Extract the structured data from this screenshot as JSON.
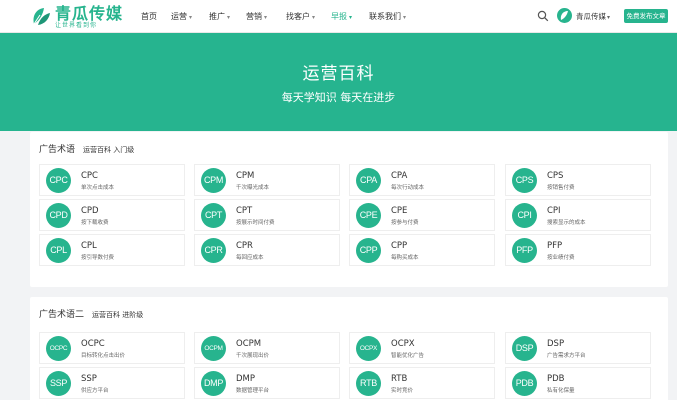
{
  "brand": {
    "name": "青瓜传媒",
    "slogan": "让世界看到你",
    "color": "#27b48e"
  },
  "nav": [
    {
      "label": "首页",
      "caret": ""
    },
    {
      "label": "运营",
      "caret": "▾"
    },
    {
      "label": "推广",
      "caret": "▾"
    },
    {
      "label": "营销",
      "caret": "▾"
    },
    {
      "label": "找客户",
      "caret": "▾"
    },
    {
      "label": "早报",
      "caret": "▾"
    },
    {
      "label": "联系我们",
      "caret": "▾"
    }
  ],
  "header": {
    "username": "青瓜传媒",
    "user_caret": "▾",
    "publish_label": "免费发布文章"
  },
  "banner": {
    "title": "运营百科",
    "subtitle": "每天学知识 每天在进步"
  },
  "section1": {
    "title": "广告术语",
    "crumb": "运营百科 入门级",
    "cards": [
      {
        "badge": "CPC",
        "term": "CPC",
        "desc": "单次点击成本"
      },
      {
        "badge": "CPM",
        "term": "CPM",
        "desc": "千次曝光成本"
      },
      {
        "badge": "CPA",
        "term": "CPA",
        "desc": "每次行动成本"
      },
      {
        "badge": "CPS",
        "term": "CPS",
        "desc": "按销售付费"
      },
      {
        "badge": "CPD",
        "term": "CPD",
        "desc": "按下载收费"
      },
      {
        "badge": "CPT",
        "term": "CPT",
        "desc": "按展示时间付费"
      },
      {
        "badge": "CPE",
        "term": "CPE",
        "desc": "按参与付费"
      },
      {
        "badge": "CPI",
        "term": "CPI",
        "desc": "搜索显示的成本"
      },
      {
        "badge": "CPL",
        "term": "CPL",
        "desc": "按引导数付费"
      },
      {
        "badge": "CPR",
        "term": "CPR",
        "desc": "每回应成本"
      },
      {
        "badge": "CPP",
        "term": "CPP",
        "desc": "每购买成本"
      },
      {
        "badge": "PFP",
        "term": "PFP",
        "desc": "按业绩付费"
      }
    ]
  },
  "section2": {
    "title": "广告术语二",
    "crumb": "运营百科 进阶级",
    "cards": [
      {
        "badge": "OCPC",
        "term": "OCPC",
        "desc": "目标转化点击出价"
      },
      {
        "badge": "OCPM",
        "term": "OCPM",
        "desc": "千次展现出价"
      },
      {
        "badge": "OCPX",
        "term": "OCPX",
        "desc": "智能优化广告"
      },
      {
        "badge": "DSP",
        "term": "DSP",
        "desc": "广告需求方平台"
      },
      {
        "badge": "SSP",
        "term": "SSP",
        "desc": "供应方平台"
      },
      {
        "badge": "DMP",
        "term": "DMP",
        "desc": "数据管理平台"
      },
      {
        "badge": "RTB",
        "term": "RTB",
        "desc": "实时竞价"
      },
      {
        "badge": "PDB",
        "term": "PDB",
        "desc": "私有化保量"
      }
    ]
  }
}
